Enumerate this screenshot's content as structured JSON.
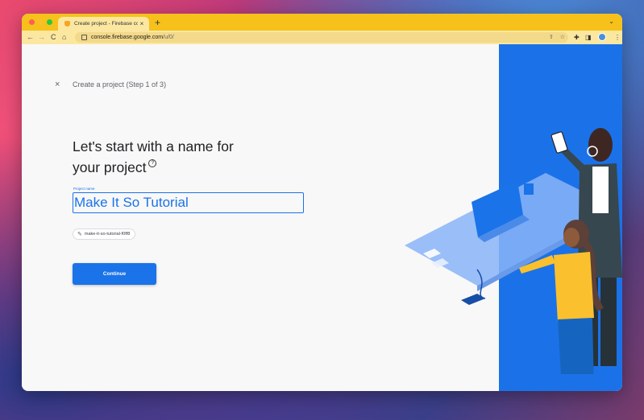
{
  "browser": {
    "tab_title": "Create project - Firebase cons",
    "tab_close": "×",
    "new_tab": "+",
    "tabstrip_chevron": "⌄",
    "url_host": "console.firebase.google.com",
    "url_path": "/u/0/",
    "nav_back": "←",
    "nav_forward": "→",
    "nav_reload": "C",
    "nav_home": "⌂",
    "omnibox_share": "⇧",
    "omnibox_star": "☆",
    "ext_puzzle": "✚",
    "ext_sidepanel": "◨",
    "menu_dots": "⋮"
  },
  "colors": {
    "tab_strip": "#f6c11b",
    "toolbar": "#fbe7a0",
    "accent": "#1a73e8",
    "panel_blue": "#1b72e8",
    "traffic_close": "#fe5f57",
    "traffic_min": "#febc2e",
    "traffic_max": "#28c840"
  },
  "page": {
    "close_label": "×",
    "step_title": "Create a project (Step 1 of 3)",
    "heading_line1": "Let's start with a name for",
    "heading_line2": "your project",
    "help_glyph": "?",
    "field_label": "Project name",
    "project_name_value": "Make It So Tutorial",
    "project_id_chip": "make-it-so-tutorial-f0ff8",
    "continue_label": "Continue"
  },
  "icons": [
    "firebase-favicon",
    "lock-icon",
    "share-icon",
    "star-icon",
    "puzzle-icon",
    "side-panel-icon",
    "profile-avatar",
    "menu-icon",
    "close-icon",
    "help-icon",
    "pencil-icon"
  ]
}
